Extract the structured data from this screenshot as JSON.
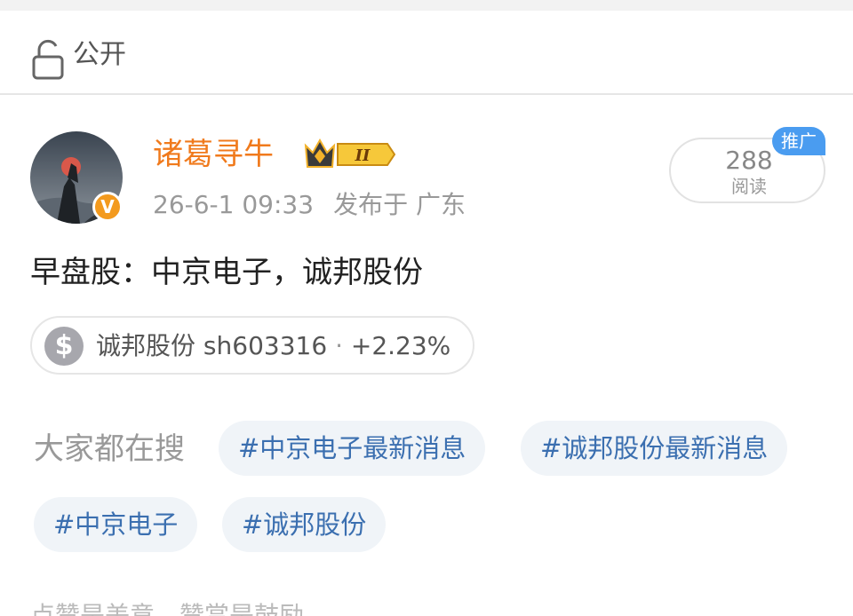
{
  "visibility": {
    "icon": "lock-open-icon",
    "label": "公开"
  },
  "author": {
    "name": "诸葛寻牛",
    "verified_badge": "V",
    "rank_badge": "II",
    "timestamp": "26-6-1 09:33",
    "published_from": "发布于 广东"
  },
  "reads": {
    "count": "288",
    "label": "阅读",
    "promo_label": "推广"
  },
  "post": {
    "text": "早盘股：中京电子，诚邦股份"
  },
  "stock_chip": {
    "icon": "dollar-icon",
    "name": "诚邦股份",
    "code": "sh603316",
    "separator": "·",
    "change": "+2.23%"
  },
  "trending": {
    "label": "大家都在搜",
    "tags": [
      "#中京电子最新消息",
      "#诚邦股份最新消息",
      "#中京电子",
      "#诚邦股份"
    ]
  },
  "footer_partial_text": "点赞是美意，赞赏是鼓励",
  "colors": {
    "username": "#f07a1c",
    "tag_text": "#3b6fb0",
    "tag_bg": "#f0f4f8",
    "promo": "#4a9cf0",
    "verified": "#f39a1e"
  }
}
